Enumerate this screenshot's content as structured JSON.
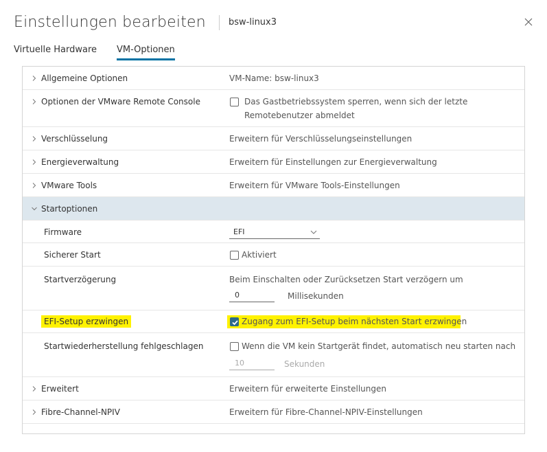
{
  "header": {
    "title": "Einstellungen bearbeiten",
    "subtitle": "bsw-linux3"
  },
  "tabs": [
    {
      "label": "Virtuelle Hardware",
      "active": false
    },
    {
      "label": "VM-Optionen",
      "active": true
    }
  ],
  "rows": {
    "general": {
      "label": "Allgemeine Optionen",
      "value": "VM-Name: bsw-linux3"
    },
    "remote_console": {
      "label": "Optionen der VMware Remote Console",
      "checkbox_line1": "Das Gastbetriebssystem sperren, wenn sich der letzte",
      "checkbox_line2": "Remotebenutzer abmeldet",
      "checked": false
    },
    "encryption": {
      "label": "Verschlüsselung",
      "value": "Erweitern für Verschlüsselungseinstellungen"
    },
    "power": {
      "label": "Energieverwaltung",
      "value": "Erweitern für Einstellungen zur Energieverwaltung"
    },
    "vmware_tools": {
      "label": "VMware Tools",
      "value": "Erweitern für VMware Tools-Einstellungen"
    },
    "boot_options": {
      "label": "Startoptionen",
      "expanded": true
    },
    "firmware": {
      "label": "Firmware",
      "value": "EFI"
    },
    "secure_boot": {
      "label": "Sicherer Start",
      "checkbox_label": "Aktiviert",
      "checked": false
    },
    "boot_delay": {
      "label": "Startverzögerung",
      "description": "Beim Einschalten oder Zurücksetzen Start verzögern um",
      "value": "0",
      "unit": "Millisekunden"
    },
    "efi_setup": {
      "label": "EFI-Setup erzwingen",
      "checkbox_label": "Zugang zum EFI-Setup beim nächsten Start erzwingen",
      "checked": true,
      "highlight_color": "#fff200"
    },
    "boot_recovery": {
      "label": "Startwiederherstellung fehlgeschlagen",
      "checkbox_label": "Wenn die VM kein Startgerät findet, automatisch neu starten nach",
      "checked": false,
      "value": "10",
      "unit": "Sekunden"
    },
    "advanced": {
      "label": "Erweitert",
      "value": "Erweitern für erweiterte Einstellungen"
    },
    "fibre_channel": {
      "label": "Fibre-Channel-NPIV",
      "value": "Erweitern für Fibre-Channel-NPIV-Einstellungen"
    }
  },
  "icons": {
    "collapsed": "chevron-right-icon",
    "expanded": "chevron-down-icon",
    "close": "close-icon",
    "dropdown": "chevron-down-icon",
    "check": "check-icon"
  },
  "colors": {
    "accent": "#0072a3",
    "section_bg": "#dde7ee",
    "checkbox_checked": "#2d6a8a"
  }
}
